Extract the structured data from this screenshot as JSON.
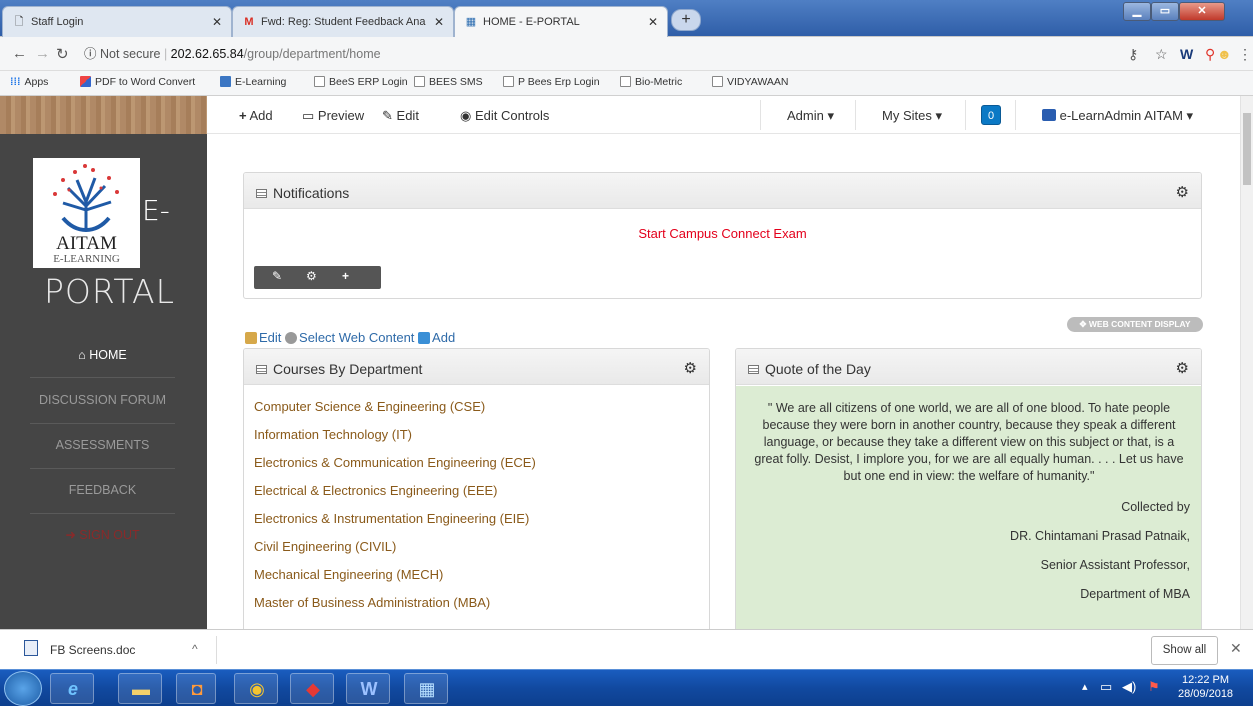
{
  "browser": {
    "tabs": [
      {
        "title": "Staff Login"
      },
      {
        "title": "Fwd: Reg: Student Feedback Ana"
      },
      {
        "title": "HOME - E-PORTAL"
      }
    ],
    "new_tab": "+",
    "address": {
      "security": "Not secure",
      "host": "202.62.65.84",
      "path": "/group/department/home"
    },
    "bookmarks": [
      "Apps",
      "PDF to Word Convert",
      "E-Learning",
      "BeeS ERP Login",
      "BEES SMS",
      "P Bees Erp Login",
      "Bio-Metric",
      "VIDYAWAAN"
    ]
  },
  "sidebar": {
    "logo_text": "AITAM",
    "logo_sub": "E-LEARNING",
    "brand_e": "E-",
    "brand_portal": "PORTAL",
    "items": [
      {
        "label": "HOME"
      },
      {
        "label": "DISCUSSION FORUM"
      },
      {
        "label": "ASSESSMENTS"
      },
      {
        "label": "FEEDBACK"
      },
      {
        "label": "SIGN OUT"
      }
    ],
    "colors": {
      "active": "#ffffff",
      "signout": "#8a2a2a"
    }
  },
  "adminbar": {
    "add": "Add",
    "preview": "Preview",
    "edit": "Edit",
    "edit_controls": "Edit Controls",
    "admin": "Admin",
    "my_sites": "My Sites",
    "notifications_count": "0",
    "user": "e-LearnAdmin AITAM"
  },
  "notifications": {
    "title": "Notifications",
    "link": "Start Campus Connect Exam"
  },
  "web_content": {
    "display_badge": "WEB CONTENT DISPLAY",
    "edit": "Edit",
    "select": "Select Web Content",
    "add": "Add"
  },
  "courses": {
    "title": "Courses By Department",
    "items": [
      "Computer Science & Engineering (CSE)",
      "Information Technology (IT)",
      "Electronics & Communication Engineering (ECE)",
      "Electrical & Electronics Engineering (EEE)",
      "Electronics & Instrumentation Engineering (EIE)",
      "Civil Engineering (CIVIL)",
      "Mechanical Engineering (MECH)",
      "Master of Business Administration (MBA)"
    ]
  },
  "quote": {
    "title": "Quote of the Day",
    "text": "\" We are all citizens of one world, we are all of one blood. To hate people because they were born in another country, because they speak a different language, or because they take a different view on this subject or that, is a great folly. Desist, I implore you, for we are all equally human. . . . Let us have but one end in view:  the welfare of humanity.\"",
    "collected": "Collected by",
    "author": "DR. Chintamani Prasad Patnaik,",
    "role": "Senior Assistant Professor,",
    "dept": "Department of MBA"
  },
  "downloads": {
    "file": "FB Screens.doc",
    "show_all": "Show all"
  },
  "taskbar": {
    "time": "12:22 PM",
    "date": "28/09/2018"
  }
}
